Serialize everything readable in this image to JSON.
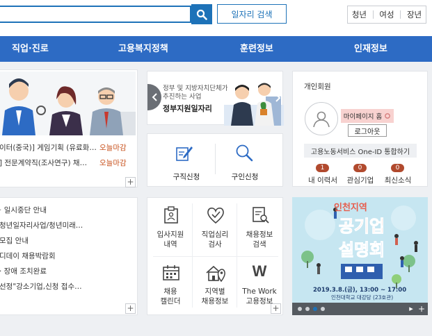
{
  "header": {
    "search": {
      "value": "",
      "placeholder": ""
    },
    "search_icon": "search-icon",
    "job_search_label": "일자리 검색",
    "targets": [
      "청년",
      "여성",
      "장년"
    ]
  },
  "nav": {
    "items": [
      "직업·진로",
      "고용복지정책",
      "훈련정보",
      "인재정보"
    ]
  },
  "jobs": {
    "rows": [
      {
        "text": "이터(중국)] 게임기획 (유료화…",
        "deadline": "오늘마감"
      },
      {
        "text": "] 전문계약직(조사연구) 채…",
        "deadline": "오늘마감"
      }
    ],
    "more": "+"
  },
  "gov_banner": {
    "line1": "정부 및 지방자치단체가",
    "line2": "추진하는 사업",
    "title": "정부지원일자리"
  },
  "quick": {
    "job_apply": "구직신청",
    "recruit_apply": "구인신청"
  },
  "notices": {
    "items": [
      "일시중단 안내",
      "청년일자리사업/청년미래…",
      "모집 안내",
      "디데이 채용박람회",
      "· 장애 조치완료",
      "선정\"강소기업,신청 접수…"
    ],
    "more": "+"
  },
  "services": {
    "items": [
      {
        "line1": "입사지원",
        "line2": "내역"
      },
      {
        "line1": "직업심리",
        "line2": "검사"
      },
      {
        "line1": "채용정보",
        "line2": "검색"
      },
      {
        "line1": "채용",
        "line2": "캘린더"
      },
      {
        "line1": "지역별",
        "line2": "채용정보"
      },
      {
        "line1": "The Work",
        "line2": "고용정보"
      }
    ],
    "more": "+",
    "w_letter": "W"
  },
  "member": {
    "title": "개인회원",
    "mypage_label": "마이페이지 홈",
    "logout_label": "로그아웃",
    "one_id_label": "고용노동서비스 One-ID 통합하기",
    "stats": [
      {
        "label": "내 이력서",
        "count": "1"
      },
      {
        "label": "관심기업",
        "count": "0"
      },
      {
        "label": "최신소식",
        "count": "0"
      }
    ]
  },
  "event_banner": {
    "region": "인천지역",
    "title1": "공기업",
    "title2": "설명회",
    "date": "2019.3.8.(금), 13:00 ~ 17:00",
    "place": "인천대학교 대강당 (23호관)",
    "more": "+",
    "play": "▸"
  },
  "colors": {
    "primary": "#2d6bc4",
    "accent": "#c8521e",
    "badge": "#b14a2e"
  }
}
